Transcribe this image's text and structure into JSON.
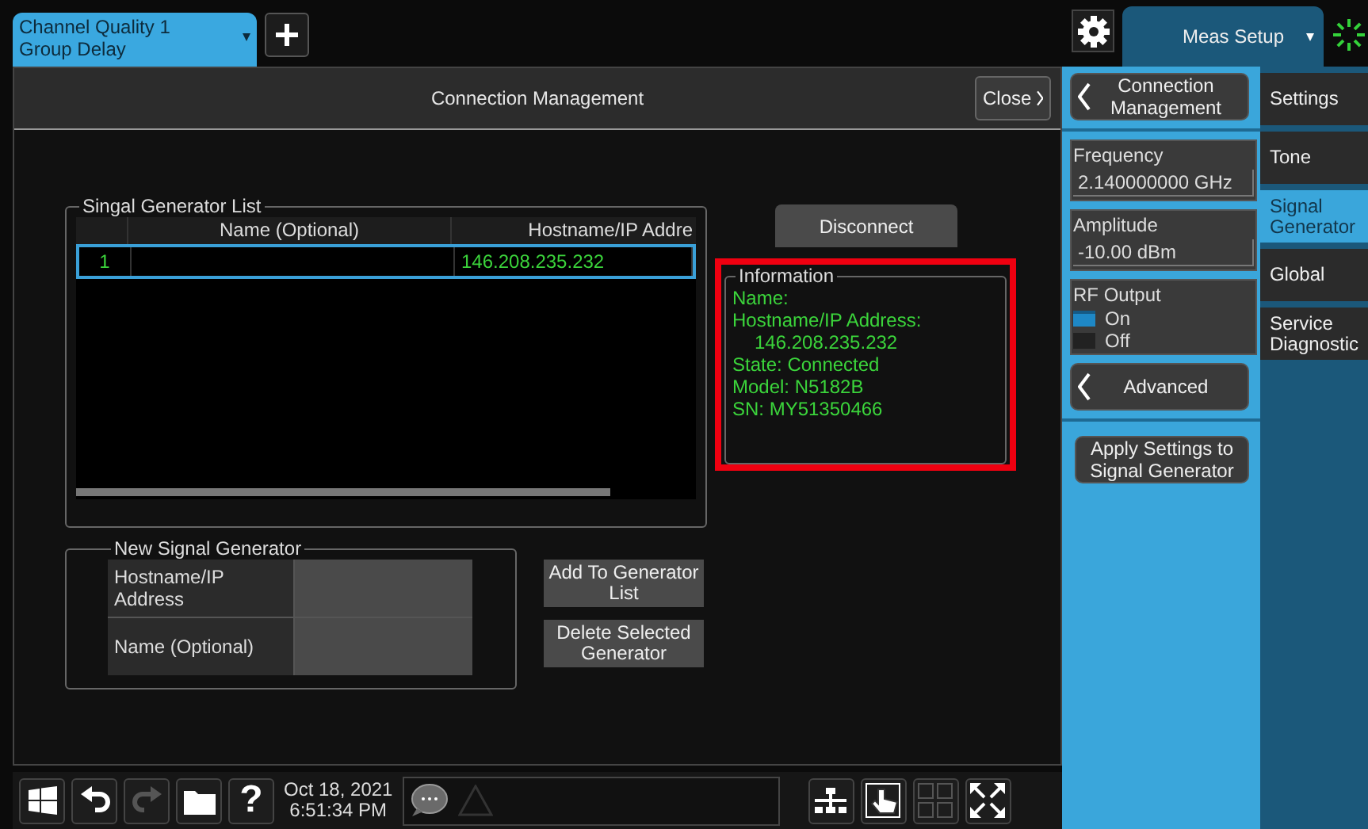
{
  "app_tab": {
    "label": "Channel Quality 1\nGroup Delay",
    "selected": true
  },
  "meas_setup": {
    "label": "Meas Setup"
  },
  "dialog": {
    "title": "Connection Management",
    "close": "Close"
  },
  "generator_list": {
    "legend": "Singal Generator List",
    "columns": [
      "Name (Optional)",
      "Hostname/IP Addre"
    ],
    "rows": [
      {
        "index": "1",
        "hostname": "146.208.235.232",
        "selected": true
      }
    ]
  },
  "disconnect": "Disconnect",
  "information": {
    "legend": "Information",
    "highlighted": true,
    "lines": [
      {
        "kind": "label",
        "text": "Name:"
      },
      {
        "kind": "label",
        "text": "Hostname/IP Address:"
      },
      {
        "kind": "continuation",
        "text": "146.208.235.232"
      },
      {
        "kind": "label",
        "text": "State: Connected"
      },
      {
        "kind": "label",
        "text": "Model: N5182B"
      },
      {
        "kind": "label",
        "text": "SN: MY51350466"
      }
    ]
  },
  "new_generator": {
    "legend": "New Signal Generator",
    "fields": [
      {
        "label": "Hostname/IP\nAddress"
      },
      {
        "label": "Name (Optional)"
      }
    ],
    "buttons": [
      "Add To Generator\nList",
      "Delete Selected\nGenerator"
    ]
  },
  "taskbar": {
    "tools": [
      {
        "kind": "windows",
        "disabled": false
      },
      {
        "kind": "undo",
        "disabled": false
      },
      {
        "kind": "redo",
        "disabled": true
      },
      {
        "kind": "folder",
        "disabled": false
      },
      {
        "kind": "help",
        "text": "?",
        "disabled": false
      }
    ],
    "date": "Oct 18, 2021",
    "time": "6:51:34 PM",
    "right_tools": [
      {
        "kind": "network",
        "disabled": false
      },
      {
        "kind": "touch",
        "disabled": false
      },
      {
        "kind": "grid",
        "disabled": true
      },
      {
        "kind": "expand",
        "disabled": false
      }
    ]
  },
  "settings_panel": {
    "back": "Connection\nManagement",
    "fields": [
      {
        "label": "Frequency",
        "value": "2.140000000 GHz"
      },
      {
        "label": "Amplitude",
        "value": "-10.00 dBm"
      }
    ],
    "rf_output": {
      "label": "RF Output",
      "options": [
        {
          "label": "On",
          "selected": true
        },
        {
          "label": "Off",
          "selected": false
        }
      ]
    },
    "advanced": "Advanced",
    "apply": "Apply Settings to\nSignal Generator"
  },
  "side_tabs": [
    {
      "label": "Settings",
      "selected": false
    },
    {
      "label": "Tone",
      "selected": false
    },
    {
      "label": "Signal\nGenerator",
      "selected": true
    },
    {
      "label": "Global",
      "selected": false
    },
    {
      "label": "Service\nDiagnostic",
      "selected": false
    }
  ]
}
